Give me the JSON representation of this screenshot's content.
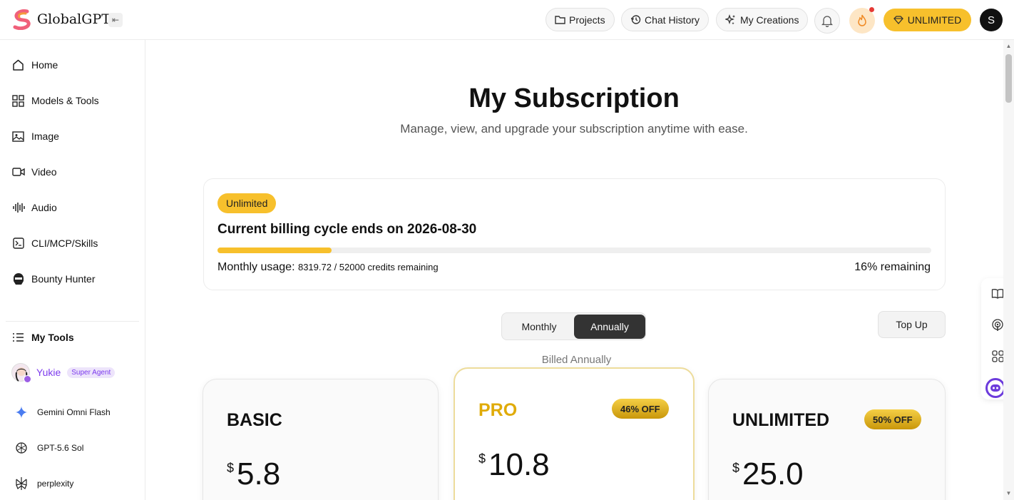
{
  "app": {
    "brand": "GlobalGPT"
  },
  "header": {
    "projects": "Projects",
    "chat_history": "Chat History",
    "my_creations": "My Creations",
    "unlimited": "UNLIMITED",
    "avatar_letter": "S"
  },
  "sidebar": {
    "items": [
      {
        "label": "Home",
        "icon": "home-icon"
      },
      {
        "label": "Models & Tools",
        "icon": "grid-icon"
      },
      {
        "label": "Image",
        "icon": "image-icon"
      },
      {
        "label": "Video",
        "icon": "video-icon"
      },
      {
        "label": "Audio",
        "icon": "audio-wave-icon"
      },
      {
        "label": "CLI/MCP/Skills",
        "icon": "terminal-icon"
      },
      {
        "label": "Bounty Hunter",
        "icon": "hunter-icon"
      }
    ],
    "my_tools_label": "My Tools",
    "tools": [
      {
        "name": "Yukie",
        "badge": "Super Agent"
      },
      {
        "name": "Gemini Omni Flash",
        "icon": "gemini-sparkle-icon"
      },
      {
        "name": "GPT-5.6 Sol",
        "icon": "openai-icon"
      },
      {
        "name": "perplexity",
        "icon": "perplexity-icon"
      }
    ]
  },
  "main": {
    "title": "My Subscription",
    "subtitle": "Manage, view, and upgrade your subscription anytime with ease."
  },
  "billing": {
    "badge": "Unlimited",
    "cycle": "Current billing cycle ends on 2026-08-30",
    "usage_label": "Monthly usage:",
    "credits": "8319.72 / 52000 credits remaining",
    "remaining_label": "16% remaining",
    "remaining_fraction": 0.16
  },
  "billing_toggle": {
    "monthly": "Monthly",
    "annually": "Annually",
    "selected": "Annually"
  },
  "topup": "Top Up",
  "billed_note": "Billed Annually",
  "plans": [
    {
      "name": "BASIC",
      "currency": "$",
      "price": "5.8",
      "discount": ""
    },
    {
      "name": "PRO",
      "currency": "$",
      "price": "10.8",
      "discount": "46% OFF"
    },
    {
      "name": "UNLIMITED",
      "currency": "$",
      "price": "25.0",
      "discount": "50% OFF"
    }
  ],
  "colors": {
    "accent": "#f7c02c",
    "pro_gold": "#e0ab08",
    "agent_purple": "#7c3aed",
    "dark_toggle": "#333333"
  }
}
